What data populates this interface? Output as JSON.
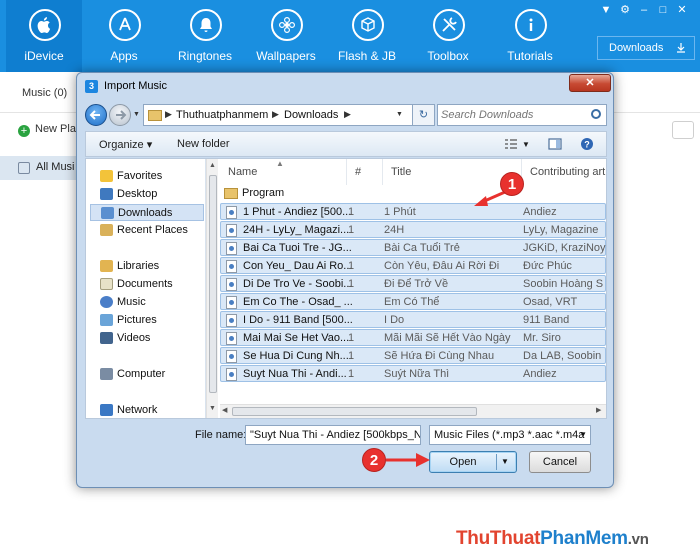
{
  "app": {
    "nav": [
      {
        "label": "iDevice",
        "icon": "apple-icon"
      },
      {
        "label": "Apps",
        "icon": "app-store-icon"
      },
      {
        "label": "Ringtones",
        "icon": "bell-icon"
      },
      {
        "label": "Wallpapers",
        "icon": "flower-icon"
      },
      {
        "label": "Flash & JB",
        "icon": "box-icon"
      },
      {
        "label": "Toolbox",
        "icon": "tools-icon"
      },
      {
        "label": "Tutorials",
        "icon": "info-icon"
      }
    ],
    "downloads_label": "Downloads",
    "music_tab": "Music (0)",
    "new_playlist": "New Pla",
    "all_music": "All Musi",
    "accent_color": "#1a8fe0"
  },
  "dialog": {
    "title": "Import Music",
    "close_label": "✕",
    "breadcrumb": [
      "Thuthuatphanmem",
      "Downloads"
    ],
    "search_placeholder": "Search Downloads",
    "toolbar": {
      "organize": "Organize ▾",
      "new_folder": "New folder"
    },
    "tree": [
      {
        "label": "Favorites",
        "icon": "star-icon"
      },
      {
        "label": "Desktop",
        "icon": "desktop-icon"
      },
      {
        "label": "Downloads",
        "icon": "downloads-folder-icon",
        "selected": true
      },
      {
        "label": "Recent Places",
        "icon": "recent-places-icon"
      },
      {
        "label": "Libraries",
        "icon": "libraries-icon"
      },
      {
        "label": "Documents",
        "icon": "documents-icon"
      },
      {
        "label": "Music",
        "icon": "music-icon"
      },
      {
        "label": "Pictures",
        "icon": "pictures-icon"
      },
      {
        "label": "Videos",
        "icon": "videos-icon"
      },
      {
        "label": "Computer",
        "icon": "computer-icon"
      },
      {
        "label": "Network",
        "icon": "network-icon"
      }
    ],
    "columns": {
      "name": "Name",
      "num": "#",
      "title": "Title",
      "artist": "Contributing art"
    },
    "files": [
      {
        "name": "Program",
        "num": "",
        "title": "",
        "artist": "",
        "folder": true
      },
      {
        "name": "1 Phut - Andiez [500...",
        "num": "1",
        "title": "1 Phút",
        "artist": "Andiez"
      },
      {
        "name": "24H - LyLy_ Magazi...",
        "num": "1",
        "title": "24H",
        "artist": "LyLy, Magazine"
      },
      {
        "name": "Bai Ca Tuoi Tre - JG...",
        "num": "",
        "title": "Bài Ca Tuổi Trẻ",
        "artist": "JGKiD, KraziNoy"
      },
      {
        "name": "Con Yeu_ Dau Ai Ro...",
        "num": "1",
        "title": "Còn Yêu, Đâu Ai Rời Đi",
        "artist": "Đức Phúc"
      },
      {
        "name": "Di De Tro Ve - Soobi...",
        "num": "1",
        "title": "Đi Để Trở Về",
        "artist": "Soobin Hoàng S"
      },
      {
        "name": "Em Co The - Osad_ ...",
        "num": "",
        "title": "Em Có Thể",
        "artist": "Osad, VRT"
      },
      {
        "name": "I Do - 911 Band [500...",
        "num": "",
        "title": "I Do",
        "artist": "911 Band"
      },
      {
        "name": "Mai Mai Se Het Vao...",
        "num": "1",
        "title": "Mãi Mãi Sẽ Hết Vào Ngày ...",
        "artist": "Mr. Siro"
      },
      {
        "name": "Se Hua Di Cung Nh...",
        "num": "1",
        "title": "Sẽ Hứa Đi Cùng Nhau",
        "artist": "Da LAB, Soobin"
      },
      {
        "name": "Suyt Nua Thi - Andi...",
        "num": "1",
        "title": "Suýt Nữa Thì",
        "artist": "Andiez"
      }
    ],
    "filename_label": "File name:",
    "filename_value": "\"Suyt Nua Thi - Andiez [500kbps_N",
    "filetype_value": "Music Files (*.mp3 *.aac *.m4a",
    "open_label": "Open",
    "cancel_label": "Cancel"
  },
  "annotations": {
    "step1": "1",
    "step2": "2",
    "color": "#e8312e"
  },
  "watermark": {
    "part1": "ThuThuat",
    "part2": "PhanMem",
    "part3": ".vn"
  }
}
